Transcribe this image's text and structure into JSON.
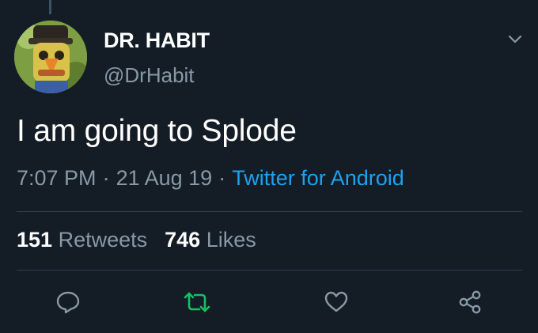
{
  "user": {
    "display_name": "DR. HABIT",
    "handle": "@DrHabit"
  },
  "tweet": {
    "text": "I am going to Splode",
    "time": "7:07 PM",
    "separator": "·",
    "date": "21 Aug 19",
    "source": "Twitter for Android"
  },
  "stats": {
    "retweets_count": "151",
    "retweets_label": "Retweets",
    "likes_count": "746",
    "likes_label": "Likes"
  },
  "icons": {
    "reply": "reply-icon",
    "retweet": "retweet-icon",
    "like": "heart-icon",
    "share": "share-icon",
    "caret": "chevron-down-icon"
  },
  "colors": {
    "background": "#141d26",
    "text_primary": "#ffffff",
    "text_secondary": "#8899a6",
    "link": "#1da1f2",
    "retweet_active": "#17bf63",
    "divider": "#2f3f4e"
  }
}
